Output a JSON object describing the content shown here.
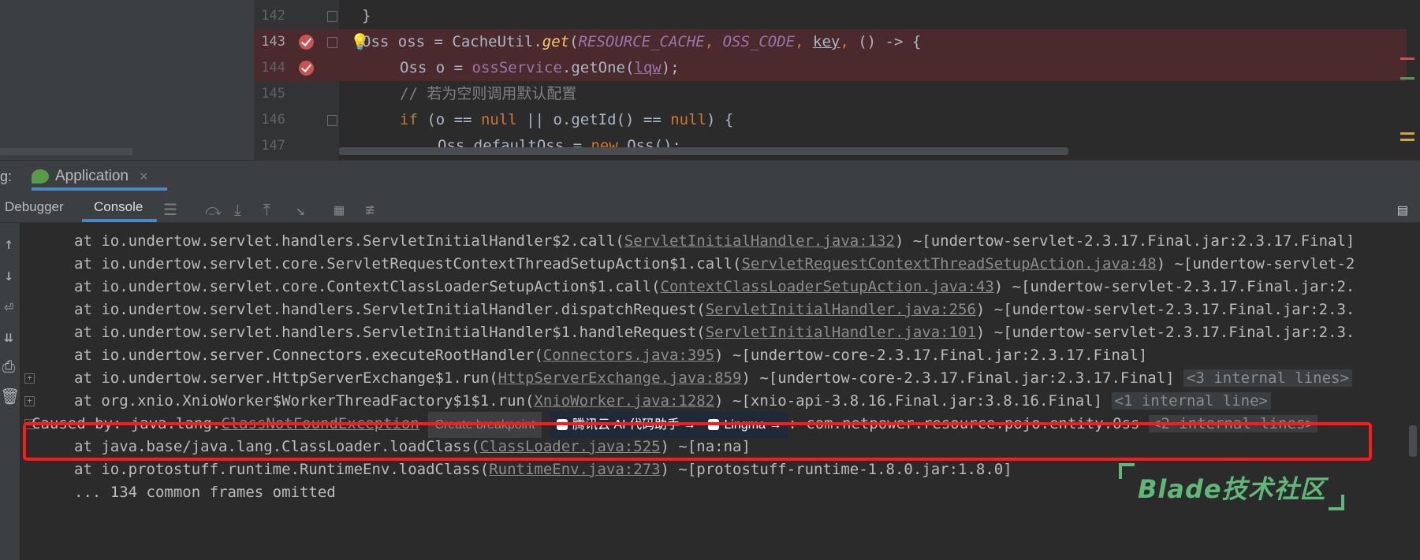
{
  "editor": {
    "lines": [
      {
        "num": "142",
        "tokens": [
          {
            "t": "}",
            "c": ""
          }
        ]
      },
      {
        "num": "143",
        "tokens": [
          {
            "t": "Oss oss = CacheUtil.",
            "c": ""
          },
          {
            "t": "get",
            "c": "fn-it"
          },
          {
            "t": "(",
            "c": ""
          },
          {
            "t": "RESOURCE_CACHE",
            "c": "it"
          },
          {
            "t": ", ",
            "c": "kw"
          },
          {
            "t": "OSS_CODE",
            "c": "it"
          },
          {
            "t": ", ",
            "c": "kw"
          },
          {
            "t": "key",
            "c": "ul"
          },
          {
            "t": ", ",
            "c": "kw"
          },
          {
            "t": "() -> {",
            "c": ""
          }
        ]
      },
      {
        "num": "144",
        "tokens": [
          {
            "t": "Oss o = ",
            "c": ""
          },
          {
            "t": "ossService",
            "c": "field"
          },
          {
            "t": ".getOne(",
            "c": ""
          },
          {
            "t": "lqw",
            "c": "violet ul"
          },
          {
            "t": ");",
            "c": ""
          }
        ]
      },
      {
        "num": "145",
        "tokens": [
          {
            "t": "// 若为空则调用默认配置",
            "c": "cmt"
          }
        ]
      },
      {
        "num": "146",
        "tokens": [
          {
            "t": "if ",
            "c": "kw"
          },
          {
            "t": "(o == ",
            "c": ""
          },
          {
            "t": "null",
            "c": "kw"
          },
          {
            "t": " || o.getId() == ",
            "c": ""
          },
          {
            "t": "null",
            "c": "kw"
          },
          {
            "t": ") {",
            "c": ""
          }
        ]
      },
      {
        "num": "147",
        "tokens": [
          {
            "t": "Oss defaultOss = ",
            "c": ""
          },
          {
            "t": "new ",
            "c": "kw"
          },
          {
            "t": "Oss();",
            "c": ""
          }
        ]
      }
    ]
  },
  "debug": {
    "label": "g:",
    "app_tab": "Application",
    "close_glyph": "×",
    "tab_debugger": "Debugger",
    "tab_console": "Console"
  },
  "console": {
    "lines": [
      {
        "pre": "at io.undertow.servlet.handlers.ServletInitialHandler$2.call(",
        "link": "ServletInitialHandler.java:132",
        "post": ") ~[undertow-servlet-2.3.17.Final.jar:2.3.17.Final]"
      },
      {
        "pre": "at io.undertow.servlet.core.ServletRequestContextThreadSetupAction$1.call(",
        "link": "ServletRequestContextThreadSetupAction.java:48",
        "post": ") ~[undertow-servlet-2"
      },
      {
        "pre": "at io.undertow.servlet.core.ContextClassLoaderSetupAction$1.call(",
        "link": "ContextClassLoaderSetupAction.java:43",
        "post": ") ~[undertow-servlet-2.3.17.Final.jar:2."
      },
      {
        "pre": "at io.undertow.servlet.handlers.ServletInitialHandler.dispatchRequest(",
        "link": "ServletInitialHandler.java:256",
        "post": ") ~[undertow-servlet-2.3.17.Final.jar:2.3."
      },
      {
        "pre": "at io.undertow.servlet.handlers.ServletInitialHandler$1.handleRequest(",
        "link": "ServletInitialHandler.java:101",
        "post": ") ~[undertow-servlet-2.3.17.Final.jar:2.3."
      },
      {
        "pre": "at io.undertow.server.Connectors.executeRootHandler(",
        "link": "Connectors.java:395",
        "post": ") ~[undertow-core-2.3.17.Final.jar:2.3.17.Final]"
      },
      {
        "pre": "at io.undertow.server.HttpServerExchange$1.run(",
        "link": "HttpServerExchange.java:859",
        "post": ") ~[undertow-core-2.3.17.Final.jar:2.3.17.Final]",
        "hint": "<3 internal lines>"
      },
      {
        "pre": "at org.xnio.XnioWorker$WorkerThreadFactory$1$1.run(",
        "link": "XnioWorker.java:1282",
        "post": ") ~[xnio-api-3.8.16.Final.jar:3.8.16.Final]",
        "hint": "<1 internal line>"
      }
    ],
    "caused": {
      "prefix": "Caused by: java.lang.",
      "link": "ClassNotFoundException",
      "chip_breakpoint": "Create breakpoint",
      "chip_tencent": "腾讯云 AI 代码助手 →",
      "chip_lingma": "Lingma →",
      "suffix": ": com.netpower.resource.pojo.entity.Oss",
      "hint": "<2 internal lines>"
    },
    "after": [
      {
        "pre": "at java.base/java.lang.ClassLoader.loadClass(",
        "link": "ClassLoader.java:525",
        "post": ") ~[na:na]"
      },
      {
        "pre": "at io.protostuff.runtime.RuntimeEnv.loadClass(",
        "link": "RuntimeEnv.java:273",
        "post": ") ~[protostuff-runtime-1.8.0.jar:1.8.0]"
      },
      {
        "pre": "... 134 common frames omitted",
        "link": "",
        "post": ""
      }
    ]
  },
  "watermark": {
    "text": "Blade技术社区"
  },
  "colors": {
    "accent": "#4a88c7",
    "error_box": "#ff1a1a",
    "watermark": "#5fb878",
    "error_line_bg": "#4a2a2d"
  }
}
